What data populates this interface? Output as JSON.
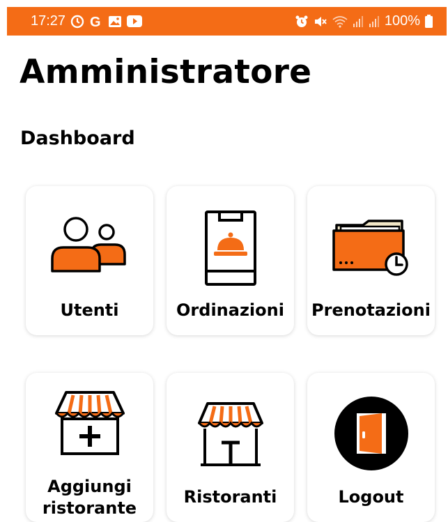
{
  "status_bar": {
    "time": "17:27",
    "battery": "100%",
    "left_icons": [
      "alarm-clock-icon",
      "google-icon",
      "gallery-icon",
      "youtube-icon"
    ],
    "right_icons": [
      "alarm-icon",
      "mute-icon",
      "wifi-icon",
      "signal-icon",
      "signal-icon",
      "battery-icon"
    ]
  },
  "header": {
    "title": "Amministratore",
    "subtitle": "Dashboard"
  },
  "tiles": [
    {
      "label": "Utenti",
      "icon": "users-icon"
    },
    {
      "label": "Ordinazioni",
      "icon": "order-cloche-icon"
    },
    {
      "label": "Prenotazioni",
      "icon": "folder-clock-icon"
    },
    {
      "label": "Aggiungi\nristorante",
      "icon": "add-store-icon"
    },
    {
      "label": "Ristoranti",
      "icon": "store-icon"
    },
    {
      "label": "Logout",
      "icon": "logout-door-icon"
    }
  ],
  "colors": {
    "accent": "#f46c16",
    "text": "#000000",
    "background": "#ffffff"
  }
}
